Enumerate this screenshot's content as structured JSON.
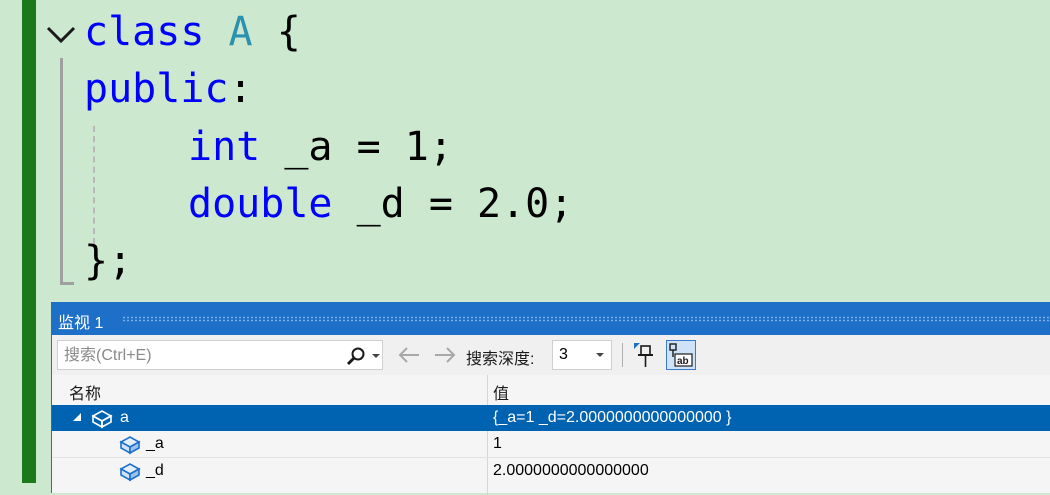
{
  "editor": {
    "lines": {
      "l1": {
        "kw": "class",
        "type_name": "A",
        "rest": " {"
      },
      "l2": {
        "kw": "public",
        "rest": ":"
      },
      "l3": {
        "kw": "int",
        "rest": " _a = 1;"
      },
      "l4": {
        "kw": "double",
        "rest": " _d = 2.0;"
      },
      "l5": {
        "rest": "};"
      }
    },
    "colors": {
      "keyword": "#0000ff",
      "type": "#2b91af",
      "background": "#cce8cf",
      "gutter": "#1a7a1a"
    }
  },
  "watch": {
    "title": "监视 1",
    "search": {
      "placeholder": "搜索(Ctrl+E)",
      "value": ""
    },
    "search_depth_label": "搜索深度:",
    "search_depth_value": "3",
    "columns": {
      "name": "名称",
      "value": "值"
    },
    "rows": [
      {
        "name": "a",
        "value": "{_a=1 _d=2.0000000000000000 }",
        "expanded": true,
        "selected": true
      },
      {
        "name": "_a",
        "value": "1"
      },
      {
        "name": "_d",
        "value": "2.0000000000000000"
      }
    ],
    "icons": {
      "search": "search-icon",
      "back": "arrow-left-icon",
      "forward": "arrow-right-icon",
      "pin": "pin-icon",
      "hex": "hex-display-icon",
      "object": "object-icon"
    },
    "colors": {
      "title_bar": "#1e6fc7",
      "selection": "#0063b1"
    }
  }
}
